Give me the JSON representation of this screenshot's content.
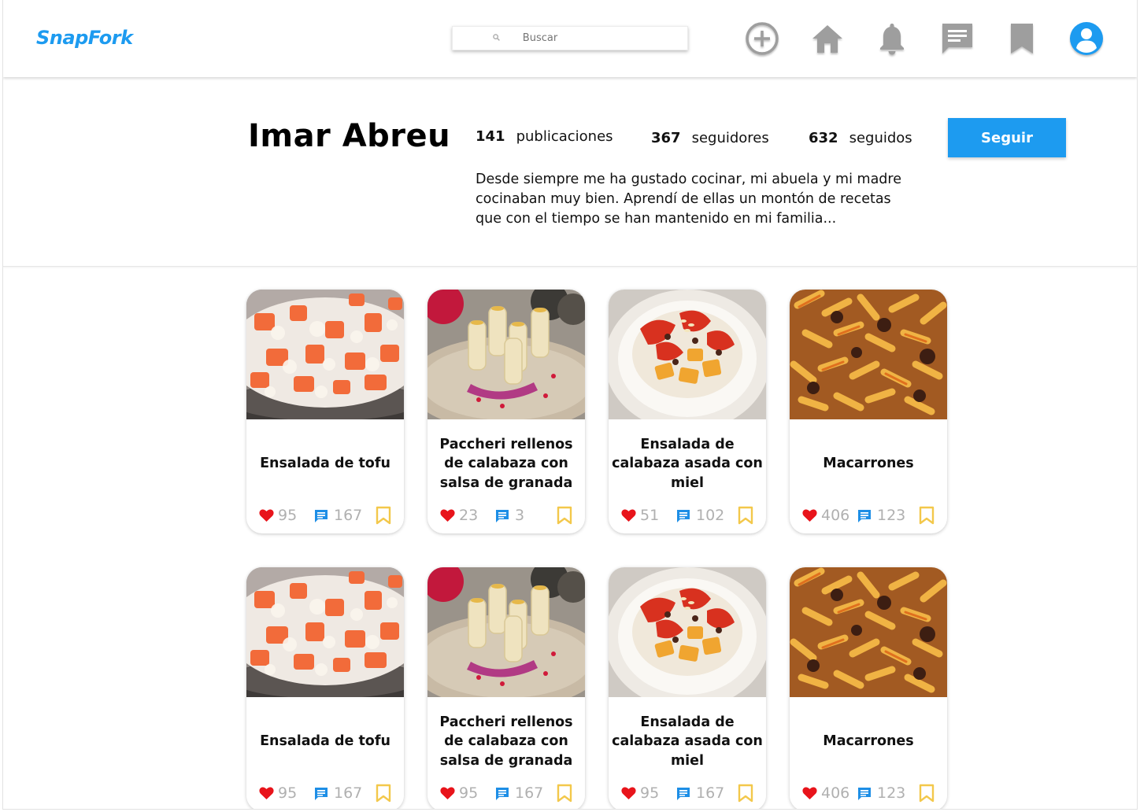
{
  "app": {
    "logo": "SnapFork"
  },
  "search": {
    "placeholder": "Buscar"
  },
  "nav": {
    "icons": [
      "add-circle-icon",
      "home-icon",
      "bell-icon",
      "chat-icon",
      "bookmark-icon",
      "user-circle-icon"
    ],
    "accent": "#1d9bf0",
    "icon_gray": "#9e9e9e"
  },
  "profile": {
    "name": "Imar Abreu",
    "posts_count": "141",
    "posts_label": "publicaciones",
    "followers_count": "367",
    "followers_label": "seguidores",
    "following_count": "632",
    "following_label": "seguidos",
    "bio": "Desde siempre me ha gustado cocinar, mi abuela y mi madre cocinaban muy bien. Aprendí de ellas un montón de recetas que con el tiempo se han mantenido en mi familia...",
    "follow_label": "Seguir"
  },
  "posts": [
    {
      "title": "Ensalada de tofu",
      "likes": "95",
      "comments": "167",
      "image": "tofu-salad"
    },
    {
      "title": "Paccheri rellenos de calabaza con salsa de granada",
      "likes": "23",
      "comments": "3",
      "image": "paccheri"
    },
    {
      "title": "Ensalada de calabaza asada con miel",
      "likes": "51",
      "comments": "102",
      "image": "pumpkin-salad"
    },
    {
      "title": "Macarrones",
      "likes": "406",
      "comments": "123",
      "image": "macaroni"
    },
    {
      "title": "Ensalada de tofu",
      "likes": "95",
      "comments": "167",
      "image": "tofu-salad"
    },
    {
      "title": "Paccheri rellenos de calabaza con salsa de granada",
      "likes": "95",
      "comments": "167",
      "image": "paccheri"
    },
    {
      "title": "Ensalada de calabaza asada con miel",
      "likes": "95",
      "comments": "167",
      "image": "pumpkin-salad"
    },
    {
      "title": "Macarrones",
      "likes": "406",
      "comments": "123",
      "image": "macaroni"
    }
  ],
  "colors": {
    "heart": "#e8141b",
    "comment": "#1d8ee6",
    "bookmark": "#f3c84b",
    "count": "#b0b0b0"
  }
}
